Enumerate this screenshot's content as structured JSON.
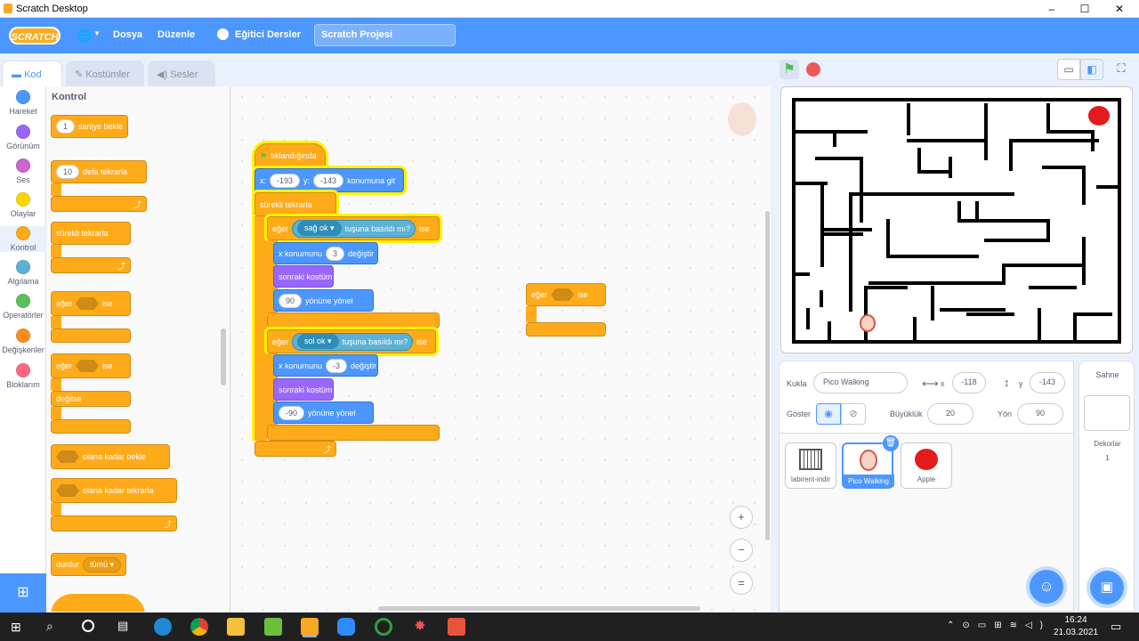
{
  "window": {
    "title": "Scratch Desktop",
    "minimize": "–",
    "maximize": "☐",
    "close": "✕"
  },
  "menubar": {
    "logo": "SCRATCH",
    "lang_icon": "🌐",
    "file": "Dosya",
    "edit": "Düzenle",
    "tutorials": "Eğitici Dersler",
    "project_title": "Scratch Projesi"
  },
  "tabs": {
    "code": "Kod",
    "costumes": "Kostümler",
    "sounds": "Sesler"
  },
  "categories": [
    {
      "label": "Hareket",
      "color": "#4c97ff"
    },
    {
      "label": "Görünüm",
      "color": "#9966ff"
    },
    {
      "label": "Ses",
      "color": "#cf63cf"
    },
    {
      "label": "Olaylar",
      "color": "#ffd500"
    },
    {
      "label": "Kontrol",
      "color": "#ffab19"
    },
    {
      "label": "Algılama",
      "color": "#5cb1d6"
    },
    {
      "label": "Operatörler",
      "color": "#59c059"
    },
    {
      "label": "Değişkenler",
      "color": "#ff8c1a"
    },
    {
      "label": "Bloklarım",
      "color": "#ff6680"
    }
  ],
  "palette": {
    "heading": "Kontrol",
    "wait_value": "1",
    "wait_label": "saniye bekle",
    "repeat_value": "10",
    "repeat_label": "defa tekrarla",
    "forever": "sürekli tekrarla",
    "if": "eğer",
    "then": "ise",
    "if2": "eğer",
    "then2": "ise",
    "else": "değilse",
    "wait_until": "olana kadar bekle",
    "repeat_until": "olana kadar tekrarla",
    "stop": "durdur",
    "stop_opt": "tümü"
  },
  "script": {
    "hat": "tıklandığında",
    "goto_x_label": "x:",
    "goto_x": "-193",
    "goto_y_label": "y:",
    "goto_y": "-143",
    "goto_label": "konumuna git",
    "forever": "sürekli tekrarla",
    "if1": "eğer",
    "key1": "sağ ok",
    "key_pressed1": "tuşuna basıldı mı?",
    "then1": "ise",
    "changex1_label": "x konumunu",
    "changex1_value": "3",
    "changex1_suffix": "değiştir",
    "next_costume1": "sonraki kostüm",
    "dir1_value": "90",
    "dir1_label": "yönüne yönel",
    "if2": "eğer",
    "key2": "sol ok",
    "key_pressed2": "tuşuna basıldı mı?",
    "then2": "ise",
    "changex2_label": "x konumunu",
    "changex2_value": "-3",
    "changex2_suffix": "değiştir",
    "next_costume2": "sonraki kostüm",
    "dir2_value": "-90",
    "dir2_label": "yönüne yönel"
  },
  "loose_block": {
    "if": "eğer",
    "then": "ise"
  },
  "zoom": {
    "in": "+",
    "out": "−",
    "reset": "="
  },
  "sprite_info": {
    "sprite_label": "Kukla",
    "sprite_name": "Pico Walking",
    "x_label": "x",
    "x": "-118",
    "y_label": "y",
    "y": "-143",
    "show_label": "Göster",
    "size_label": "Büyüklük",
    "size": "20",
    "dir_label": "Yön",
    "direction": "90"
  },
  "sprites": [
    {
      "name": "labirent-indir"
    },
    {
      "name": "Pico Walking",
      "selected": true
    },
    {
      "name": "Apple"
    }
  ],
  "stage_panel": {
    "title": "Sahne",
    "backdrops_label": "Dekorlar",
    "backdrops_count": "1"
  },
  "taskbar": {
    "time": "16:24",
    "date": "21.03.2021"
  }
}
